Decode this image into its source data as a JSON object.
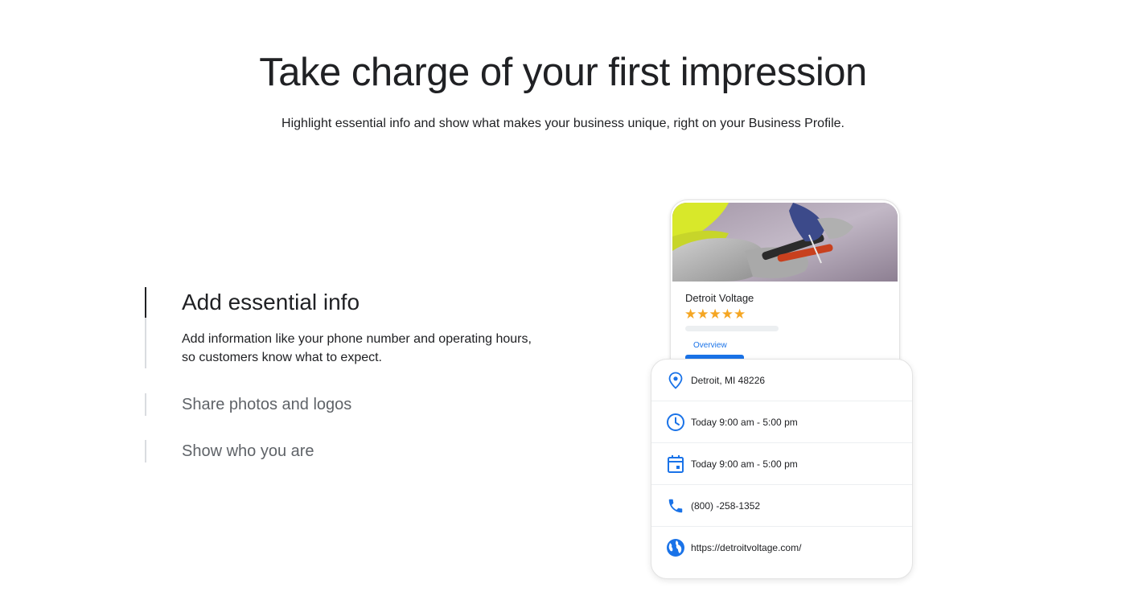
{
  "hero": {
    "title": "Take charge of your first impression",
    "subtitle": "Highlight essential info and show what makes your business unique, right on your Business Profile."
  },
  "accordion": {
    "items": [
      {
        "title": "Add essential info",
        "description": "Add information like your phone number and operating hours, so customers know what to expect.",
        "active": true
      },
      {
        "title": "Share photos and logos",
        "active": false
      },
      {
        "title": "Show who you are",
        "active": false
      }
    ]
  },
  "profile": {
    "business_name": "Detroit Voltage",
    "stars": "★★★★★",
    "rating": 5,
    "tab_label": "Overview",
    "info_rows": [
      {
        "icon": "location-pin-icon",
        "text": "Detroit, MI 48226"
      },
      {
        "icon": "clock-icon",
        "text": "Today 9:00 am - 5:00 pm"
      },
      {
        "icon": "calendar-icon",
        "text": "Today 9:00 am - 5:00 pm"
      },
      {
        "icon": "phone-icon",
        "text": "(800) -258-1352"
      },
      {
        "icon": "globe-icon",
        "text": "https://detroitvoltage.com/"
      }
    ]
  },
  "colors": {
    "accent": "#1a73e8",
    "star": "#f5a623",
    "text": "#202124",
    "muted": "#5f6368"
  }
}
